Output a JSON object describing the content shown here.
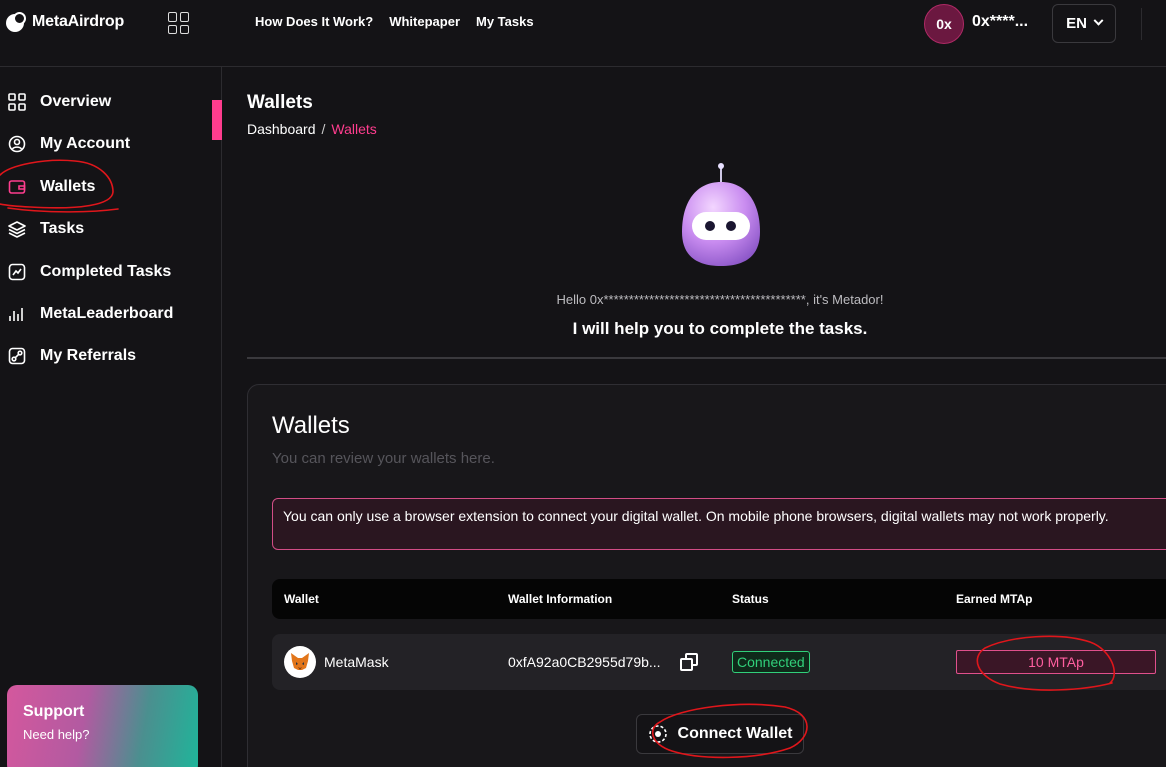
{
  "brand": {
    "name": "MetaAirdrop"
  },
  "topnav": {
    "links": [
      "How Does It Work?",
      "Whitepaper",
      "My Tasks"
    ],
    "avatar": "0x",
    "address": "0x****...",
    "language": "EN"
  },
  "sidebar": {
    "items": [
      {
        "label": "Overview",
        "icon": "grid-icon"
      },
      {
        "label": "My Account",
        "icon": "user-circle-icon"
      },
      {
        "label": "Wallets",
        "icon": "wallet-icon",
        "active": true
      },
      {
        "label": "Tasks",
        "icon": "layers-icon"
      },
      {
        "label": "Completed Tasks",
        "icon": "completed-tasks-icon"
      },
      {
        "label": "MetaLeaderboard",
        "icon": "bar-chart-icon"
      },
      {
        "label": "My Referrals",
        "icon": "referrals-icon"
      }
    ],
    "support": {
      "title": "Support",
      "subtitle": "Need help?"
    }
  },
  "page": {
    "title": "Wallets",
    "breadcrumb": [
      "Dashboard",
      "/",
      "Wallets"
    ],
    "greeting": "Hello 0x****************************************, it's Metador!",
    "help_text": "I will help you to complete the tasks."
  },
  "wallets_card": {
    "title": "Wallets",
    "subtitle": "You can review your wallets here.",
    "alert": "You can only use a browser extension to connect your digital wallet. On mobile phone browsers, digital wallets may not work properly.",
    "columns": [
      "Wallet",
      "Wallet Information",
      "Status",
      "Earned MTAp"
    ],
    "rows": [
      {
        "wallet": "MetaMask",
        "info": "0xfA92a0CB2955d79b...",
        "status": "Connected",
        "earned": "10 MTAp"
      }
    ],
    "connect_label": "Connect Wallet"
  },
  "colors": {
    "accent": "#ff3d8e",
    "success": "#31d07a",
    "background": "#141316"
  }
}
